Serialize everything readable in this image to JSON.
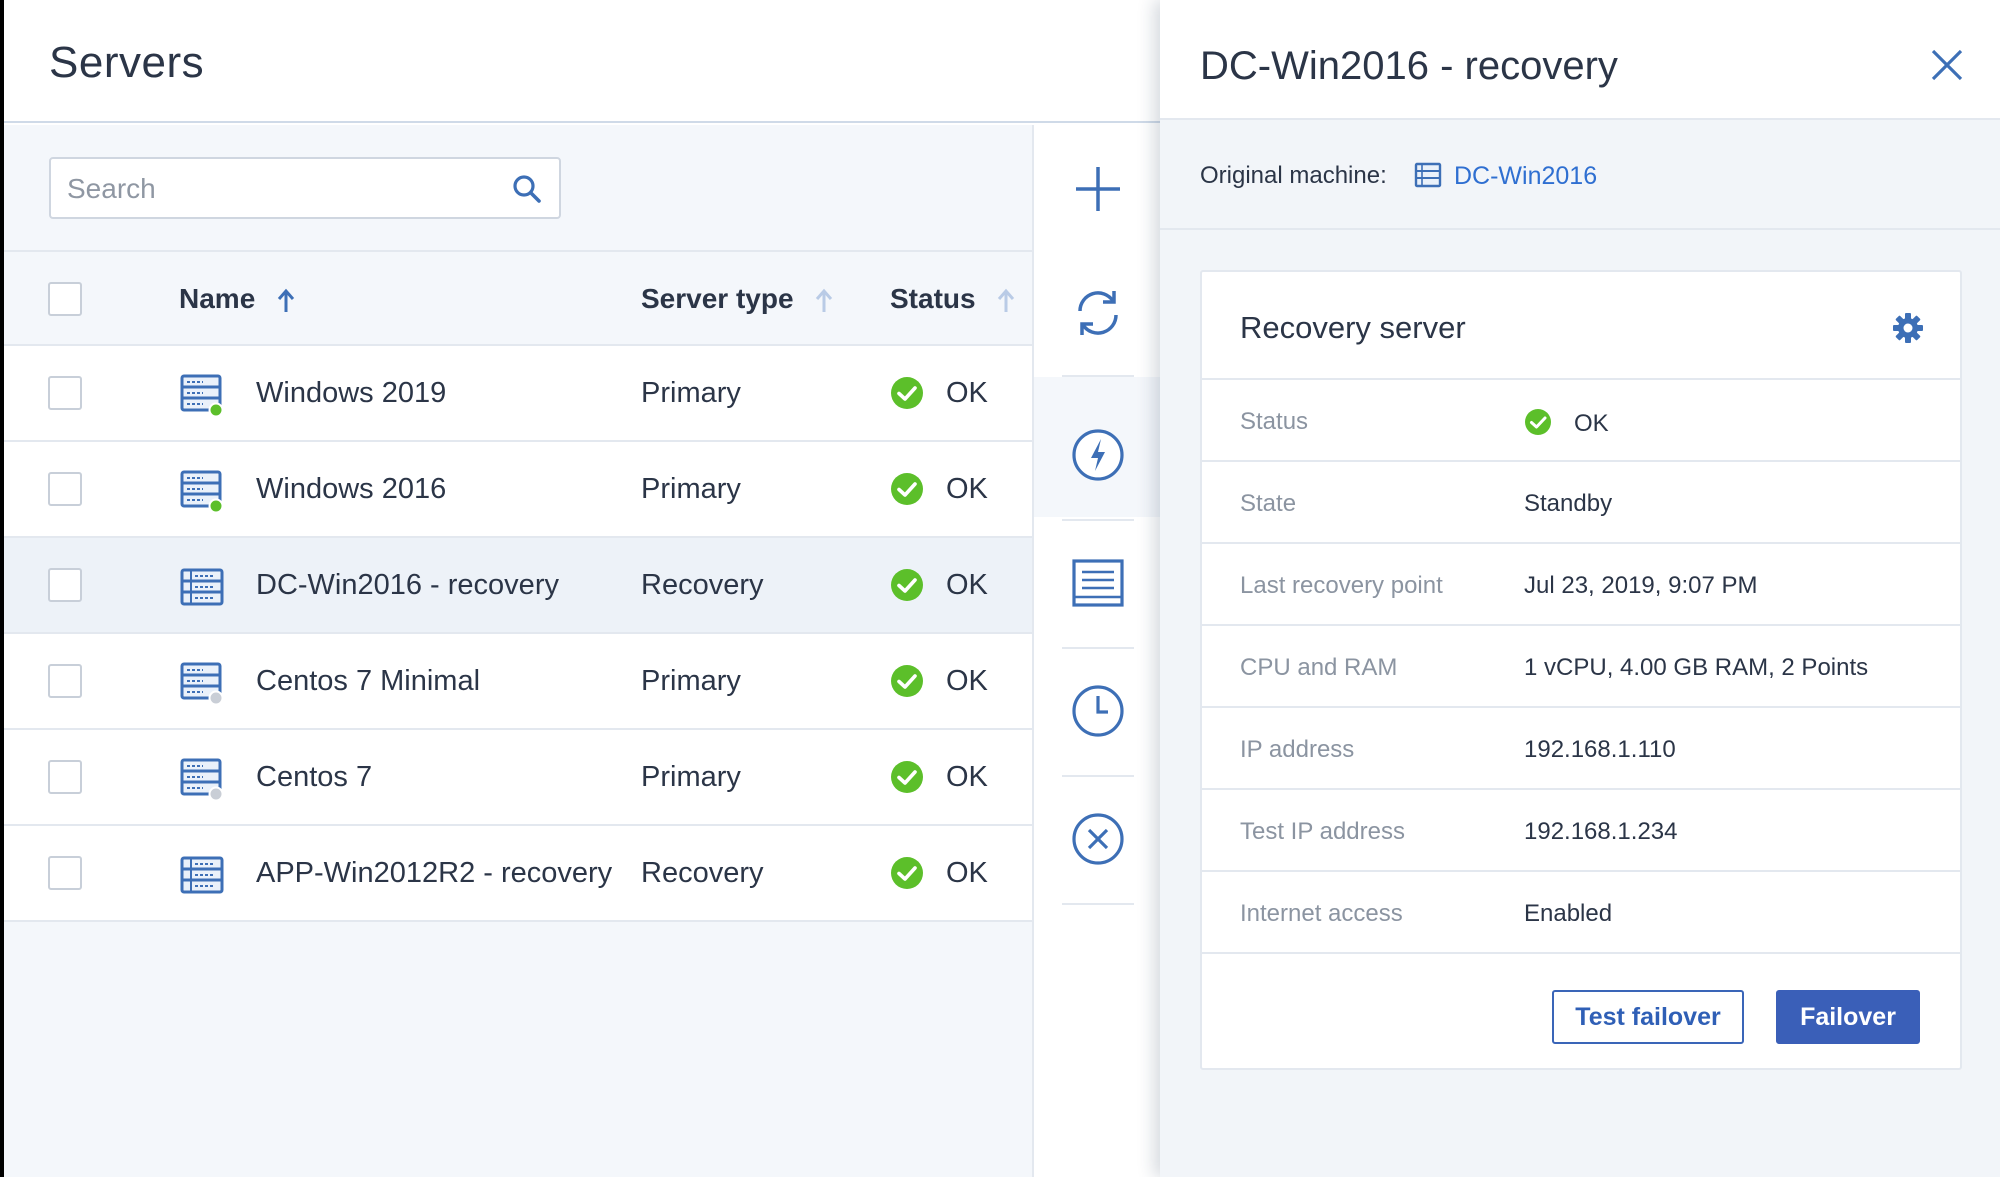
{
  "page": {
    "title": "Servers"
  },
  "search": {
    "placeholder": "Search",
    "value": ""
  },
  "table": {
    "columns": {
      "name": "Name",
      "server_type": "Server type",
      "status": "Status"
    },
    "rows": [
      {
        "name": "Windows 2019",
        "type": "Primary",
        "status": "OK",
        "power": "on",
        "selected": false
      },
      {
        "name": "Windows 2016",
        "type": "Primary",
        "status": "OK",
        "power": "on",
        "selected": false
      },
      {
        "name": "DC-Win2016 - recovery",
        "type": "Recovery",
        "status": "OK",
        "power": "none",
        "selected": true
      },
      {
        "name": "Centos 7 Minimal",
        "type": "Primary",
        "status": "OK",
        "power": "off",
        "selected": false
      },
      {
        "name": "Centos 7",
        "type": "Primary",
        "status": "OK",
        "power": "off",
        "selected": false
      },
      {
        "name": "APP-Win2012R2 - recovery",
        "type": "Recovery",
        "status": "OK",
        "power": "none",
        "selected": false
      }
    ]
  },
  "toolbar": {
    "icons": [
      "add-icon",
      "refresh-icon",
      "failover-icon",
      "details-icon",
      "schedule-icon",
      "delete-icon"
    ]
  },
  "details": {
    "title": "DC-Win2016 - recovery",
    "original_machine_label": "Original machine:",
    "original_machine": "DC-Win2016",
    "card_title": "Recovery server",
    "properties": {
      "status": {
        "label": "Status",
        "value": "OK"
      },
      "state": {
        "label": "State",
        "value": "Standby"
      },
      "last_recovery": {
        "label": "Last recovery point",
        "value": "Jul 23, 2019, 9:07 PM"
      },
      "cpu_ram": {
        "label": "CPU and RAM",
        "value": "1 vCPU, 4.00 GB RAM, 2 Points"
      },
      "ip": {
        "label": "IP address",
        "value": "192.168.1.110"
      },
      "test_ip": {
        "label": "Test IP address",
        "value": "192.168.1.234"
      },
      "internet": {
        "label": "Internet access",
        "value": "Enabled"
      }
    },
    "buttons": {
      "test_failover": "Test failover",
      "failover": "Failover"
    }
  },
  "colors": {
    "accent": "#3a5fb8",
    "link": "#2f6fd1",
    "ok_green": "#5cbf2a",
    "power_on": "#5cbf2a",
    "power_off": "#c9ced6",
    "icon_blue": "#3d6fb6"
  }
}
